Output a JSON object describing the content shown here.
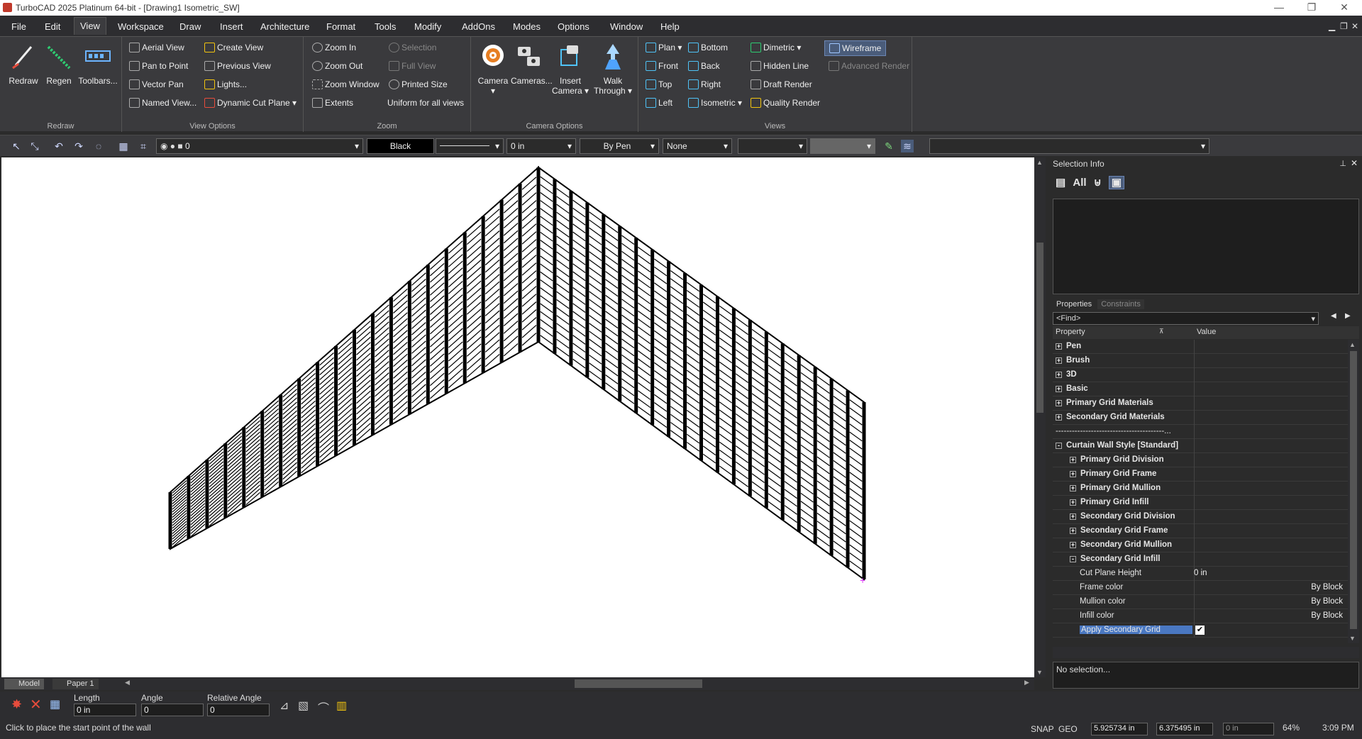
{
  "window": {
    "title": "TurboCAD 2025 Platinum 64-bit - [Drawing1 Isometric_SW]"
  },
  "menu": [
    "File",
    "Edit",
    "View",
    "Workspace",
    "Draw",
    "Insert",
    "Architecture",
    "Format",
    "Tools",
    "Modify",
    "AddOns",
    "Modes",
    "Options",
    "Window",
    "Help"
  ],
  "ribbon": {
    "redraw": {
      "redraw": "Redraw",
      "regen": "Regen",
      "toolbars": "Toolbars...",
      "label": "Redraw"
    },
    "view_options": {
      "aerial": "Aerial View",
      "pan_point": "Pan to Point",
      "vector_pan": "Vector Pan",
      "named_view": "Named View...",
      "create_view": "Create View",
      "previous_view": "Previous View",
      "lights": "Lights...",
      "cut_plane": "Dynamic Cut Plane",
      "label": "View Options"
    },
    "zoom": {
      "zoom_in": "Zoom In",
      "zoom_out": "Zoom Out",
      "zoom_window": "Zoom Window",
      "extents": "Extents",
      "selection": "Selection",
      "full_view": "Full View",
      "printed_size": "Printed Size",
      "uniform": "Uniform for all views",
      "label": "Zoom"
    },
    "camera": {
      "camera": "Camera",
      "cameras": "Cameras...",
      "insert_camera_1": "Insert",
      "insert_camera_2": "Camera",
      "walk_1": "Walk",
      "walk_2": "Through",
      "label": "Camera Options"
    },
    "views": {
      "plan": "Plan",
      "front": "Front",
      "top": "Top",
      "left": "Left",
      "bottom": "Bottom",
      "back": "Back",
      "right": "Right",
      "isometric": "Isometric",
      "dimetric": "Dimetric",
      "hidden_line": "Hidden Line",
      "draft_render": "Draft Render",
      "quality_render": "Quality Render",
      "wireframe": "Wireframe",
      "advanced_render": "Advanced Render",
      "label": "Views"
    }
  },
  "toolbar": {
    "layer": "0",
    "color": "Black",
    "width": "0 in",
    "pen": "By Pen",
    "none": "None"
  },
  "tabs": {
    "model": "Model",
    "paper": "Paper 1"
  },
  "panel": {
    "title": "Selection Info",
    "all": "All",
    "tab_properties": "Properties",
    "tab_constraints": "Constraints",
    "find": "<Find>",
    "col_property": "Property",
    "col_value": "Value",
    "rows": [
      {
        "k": "Pen",
        "v": "",
        "lvl": 0,
        "exp": "+"
      },
      {
        "k": "Brush",
        "v": "",
        "lvl": 0,
        "exp": "+"
      },
      {
        "k": "3D",
        "v": "",
        "lvl": 0,
        "exp": "+"
      },
      {
        "k": "Basic",
        "v": "",
        "lvl": 0,
        "exp": "+"
      },
      {
        "k": "Primary Grid Materials",
        "v": "",
        "lvl": 0,
        "exp": "+"
      },
      {
        "k": "Secondary Grid Materials",
        "v": "",
        "lvl": 0,
        "exp": "+"
      },
      {
        "k": "----------------------------------------...",
        "v": "",
        "lvl": 0,
        "exp": ""
      },
      {
        "k": "Curtain Wall Style [Standard]",
        "v": "",
        "lvl": 0,
        "exp": "-"
      },
      {
        "k": "Primary Grid Division",
        "v": "",
        "lvl": 1,
        "exp": "+"
      },
      {
        "k": "Primary Grid Frame",
        "v": "",
        "lvl": 1,
        "exp": "+"
      },
      {
        "k": "Primary Grid Mullion",
        "v": "",
        "lvl": 1,
        "exp": "+"
      },
      {
        "k": "Primary Grid Infill",
        "v": "",
        "lvl": 1,
        "exp": "+"
      },
      {
        "k": "Secondary Grid Division",
        "v": "",
        "lvl": 1,
        "exp": "+"
      },
      {
        "k": "Secondary Grid Frame",
        "v": "",
        "lvl": 1,
        "exp": "+"
      },
      {
        "k": "Secondary Grid Mullion",
        "v": "",
        "lvl": 1,
        "exp": "+"
      },
      {
        "k": "Secondary Grid Infill",
        "v": "",
        "lvl": 1,
        "exp": "-"
      },
      {
        "k": "Cut Plane Height",
        "v": "0 in",
        "lvl": 2,
        "exp": ""
      },
      {
        "k": "Frame color",
        "v": "By Block",
        "lvl": 2,
        "exp": ""
      },
      {
        "k": "Mullion color",
        "v": "By Block",
        "lvl": 2,
        "exp": ""
      },
      {
        "k": "Infill color",
        "v": "By Block",
        "lvl": 2,
        "exp": ""
      },
      {
        "k": "Apply Secondary Grid",
        "v": "",
        "lvl": 2,
        "exp": ""
      }
    ],
    "no_selection": "No selection..."
  },
  "inspector": {
    "length_label": "Length",
    "length": "0 in",
    "angle_label": "Angle",
    "angle": "0",
    "rel_angle_label": "Relative Angle",
    "rel_angle": "0"
  },
  "status": {
    "prompt": "Click to place the start point of the wall",
    "snap": "SNAP",
    "geo": "GEO",
    "x": "5.925734 in",
    "y": "6.375495 in",
    "z": "0 in",
    "zoom": "64%",
    "time": "3:09 PM"
  }
}
